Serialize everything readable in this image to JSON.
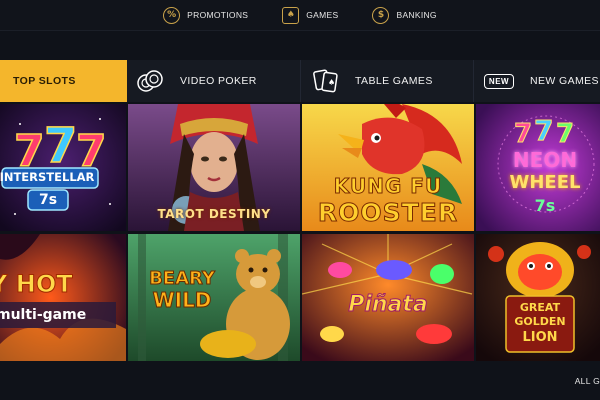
{
  "topnav": {
    "items": [
      {
        "label": "PROMOTIONS",
        "icon": "percent-icon"
      },
      {
        "label": "GAMES",
        "icon": "cards-icon"
      },
      {
        "label": "BANKING",
        "icon": "dollar-icon"
      }
    ]
  },
  "tabs": [
    {
      "label": "TOP SLOTS",
      "active": true
    },
    {
      "label": "VIDEO POKER",
      "icon": "poker-chips-icon"
    },
    {
      "label": "TABLE GAMES",
      "icon": "playing-cards-icon"
    },
    {
      "label": "NEW GAMES",
      "icon": "new-badge-icon",
      "badge": "NEW"
    }
  ],
  "games": [
    {
      "title_line1": "INTERSTELLAR",
      "title_line2": "7s"
    },
    {
      "title_line1": "TAROT DESTINY"
    },
    {
      "title_line1": "KUNG FU",
      "title_line2": "ROOSTER"
    },
    {
      "title_line1": "NEON",
      "title_line2": "WHEEL",
      "title_line3": "7s"
    },
    {
      "title_line1": "Y HOT",
      "title_line2": "multi-game"
    },
    {
      "title_line1": "BEARY",
      "title_line2": "WILD"
    },
    {
      "title_line1": "Piñata"
    },
    {
      "title_line1": "GREAT",
      "title_line2": "GOLDEN",
      "title_line3": "LION"
    }
  ],
  "footer": {
    "all_link": "ALL G"
  },
  "colors": {
    "accent": "#f4b62c",
    "background": "#0f1219",
    "tab_bar": "#161a22"
  }
}
